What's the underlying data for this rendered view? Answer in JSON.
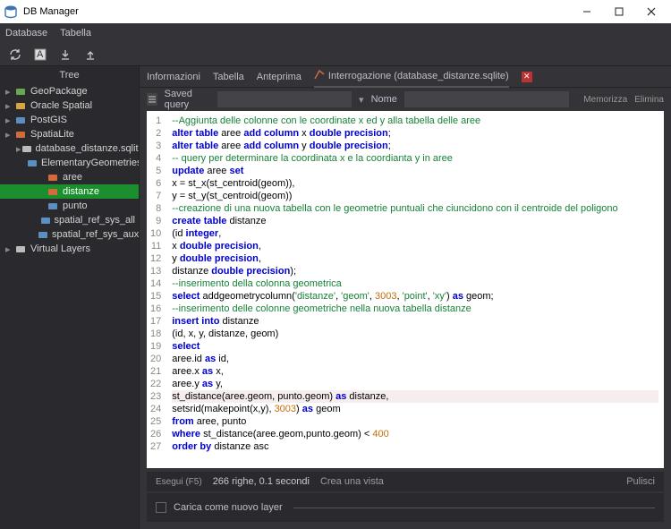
{
  "window": {
    "title": "DB Manager"
  },
  "menu": {
    "database": "Database",
    "table": "Tabella"
  },
  "sidebar": {
    "header": "Tree",
    "items": [
      {
        "label": "GeoPackage",
        "indent": 0,
        "icon": "geopackage",
        "color": "#6aa84f"
      },
      {
        "label": "Oracle Spatial",
        "indent": 0,
        "icon": "oracle",
        "color": "#d9a441"
      },
      {
        "label": "PostGIS",
        "indent": 0,
        "icon": "postgis",
        "color": "#5b8fbf"
      },
      {
        "label": "SpatiaLite",
        "indent": 0,
        "icon": "spatialite",
        "color": "#d26a3b"
      },
      {
        "label": "database_distanze.sqlite",
        "indent": 1,
        "icon": "db",
        "color": "#bbb"
      },
      {
        "label": "ElementaryGeometries",
        "indent": 2,
        "icon": "layer",
        "color": "#5b8fbf"
      },
      {
        "label": "aree",
        "indent": 3,
        "icon": "poly",
        "color": "#d26a3b"
      },
      {
        "label": "distanze",
        "indent": 3,
        "icon": "tbl",
        "color": "#d26a3b",
        "selected": true
      },
      {
        "label": "punto",
        "indent": 3,
        "icon": "pt",
        "color": "#5b8fbf"
      },
      {
        "label": "spatial_ref_sys_all",
        "indent": 3,
        "icon": "layer",
        "color": "#5b8fbf"
      },
      {
        "label": "spatial_ref_sys_aux",
        "indent": 3,
        "icon": "layer",
        "color": "#5b8fbf"
      },
      {
        "label": "Virtual Layers",
        "indent": 0,
        "icon": "vl",
        "color": "#bbb"
      }
    ]
  },
  "tabs": {
    "t1": "Informazioni",
    "t2": "Tabella",
    "t3": "Anteprima",
    "t4": "Interrogazione (database_distanze.sqlite)"
  },
  "query": {
    "saved": "Saved query",
    "name": "Nome",
    "mem": "Memorizza",
    "del": "Elimina"
  },
  "code": {
    "lines": [
      {
        "n": 1,
        "t": "--Aggiunta delle colonne con le coordinate x ed y alla tabella delle aree",
        "c": "cm"
      },
      {
        "n": 2,
        "t": "<kw>alter table</kw> aree <kw>add column</kw> x <kw>double precision</kw>;"
      },
      {
        "n": 3,
        "t": "<kw>alter table</kw> aree <kw>add column</kw> y <kw>double precision</kw>;"
      },
      {
        "n": 4,
        "t": "-- query per determinare la coordinata x e la coordianta y in aree",
        "c": "cm"
      },
      {
        "n": 5,
        "t": "<kw>update</kw> aree <kw>set</kw>"
      },
      {
        "n": 6,
        "t": "x = st_x(st_centroid(geom)),"
      },
      {
        "n": 7,
        "t": "y = st_y(st_centroid(geom))"
      },
      {
        "n": 8,
        "t": "--creazione di una nuova tabella con le geometrie puntuali che ciuncidono con il centroide del poligono",
        "c": "cm"
      },
      {
        "n": 9,
        "t": "<kw>create table</kw> distanze"
      },
      {
        "n": 10,
        "t": "(id <kw>integer</kw>,"
      },
      {
        "n": 11,
        "t": "x <kw>double precision</kw>,"
      },
      {
        "n": 12,
        "t": "y <kw>double precision</kw>,"
      },
      {
        "n": 13,
        "t": "distanze <kw>double precision</kw>);"
      },
      {
        "n": 14,
        "t": "--inserimento della colonna geometrica",
        "c": "cm"
      },
      {
        "n": 15,
        "t": "<kw>select</kw> addgeometrycolumn(<str>'distanze'</str>, <str>'geom'</str>, <num>3003</num>, <str>'point'</str>, <str>'xy'</str>) <kw>as</kw> geom;"
      },
      {
        "n": 16,
        "t": "--inserimento delle colonne geometriche nella nuova tabella distanze",
        "c": "cm"
      },
      {
        "n": 17,
        "t": "<kw>insert into</kw> distanze"
      },
      {
        "n": 18,
        "t": "(id, x, y, distanze, geom)"
      },
      {
        "n": 19,
        "t": "<kw>select</kw>"
      },
      {
        "n": 20,
        "t": "aree.id <kw>as</kw> id,"
      },
      {
        "n": 21,
        "t": "aree.x <kw>as</kw> x,"
      },
      {
        "n": 22,
        "t": "aree.y <kw>as</kw> y,"
      },
      {
        "n": 23,
        "t": "st_distance(aree.geom, punto.geom) <kw>as</kw> distanze,",
        "cur": true
      },
      {
        "n": 24,
        "t": "setsrid(makepoint(x,y), <num>3003</num>) <kw>as</kw> geom"
      },
      {
        "n": 25,
        "t": "<kw>from</kw> aree, punto"
      },
      {
        "n": 26,
        "t": "<kw>where</kw> st_distance(aree.geom,punto.geom) &lt; <num>400</num>"
      },
      {
        "n": 27,
        "t": "<kw>order by</kw> distanze asc"
      }
    ]
  },
  "status": {
    "exec": "Esegui (F5)",
    "rows": "266 righe, 0.1 secondi",
    "view": "Crea una vista",
    "clear": "Pulisci"
  },
  "layer": {
    "label": "Carica come nuovo layer"
  }
}
